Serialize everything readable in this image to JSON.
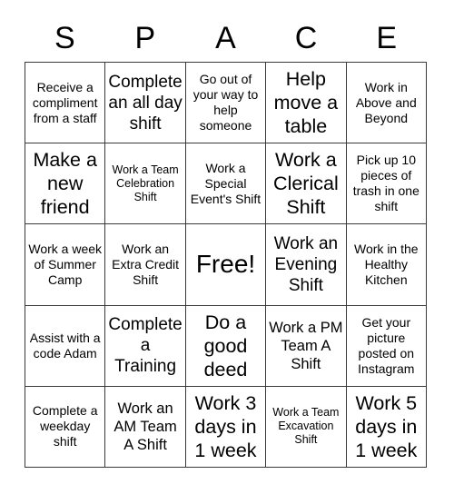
{
  "card": {
    "header_letters": [
      "S",
      "P",
      "A",
      "C",
      "E"
    ],
    "free_space_label": "Free!",
    "rows": [
      [
        {
          "text": "Receive a compliment from a staff",
          "size": "fs-sm"
        },
        {
          "text": "Complete an all day shift",
          "size": "fs-lg"
        },
        {
          "text": "Go out of your way to help someone",
          "size": "fs-sm"
        },
        {
          "text": "Help move a table",
          "size": "fs-xl"
        },
        {
          "text": "Work in Above and Beyond",
          "size": "fs-sm"
        }
      ],
      [
        {
          "text": "Make a new friend",
          "size": "fs-xl"
        },
        {
          "text": "Work a Team Celebration Shift",
          "size": "fs-xs"
        },
        {
          "text": "Work a Special Event's Shift",
          "size": "fs-sm"
        },
        {
          "text": "Work a Clerical Shift",
          "size": "fs-xl"
        },
        {
          "text": "Pick up 10 pieces of trash in one shift",
          "size": "fs-sm"
        }
      ],
      [
        {
          "text": "Work a week of Summer Camp",
          "size": "fs-sm"
        },
        {
          "text": "Work an Extra Credit Shift",
          "size": "fs-sm"
        },
        {
          "text": "Free!",
          "size": "fs-free"
        },
        {
          "text": "Work an Evening Shift",
          "size": "fs-lg"
        },
        {
          "text": "Work in the Healthy Kitchen",
          "size": "fs-sm"
        }
      ],
      [
        {
          "text": "Assist with a code Adam",
          "size": "fs-sm"
        },
        {
          "text": "Complete a Training",
          "size": "fs-lg"
        },
        {
          "text": "Do a good deed",
          "size": "fs-xl"
        },
        {
          "text": "Work a PM Team A Shift",
          "size": "fs-md"
        },
        {
          "text": "Get your picture posted on Instagram",
          "size": "fs-sm"
        }
      ],
      [
        {
          "text": "Complete a weekday shift",
          "size": "fs-sm"
        },
        {
          "text": "Work an AM Team A Shift",
          "size": "fs-md"
        },
        {
          "text": "Work 3 days in 1 week",
          "size": "fs-xl"
        },
        {
          "text": "Work a Team Excavation Shift",
          "size": "fs-xs"
        },
        {
          "text": "Work 5 days in 1 week",
          "size": "fs-xl"
        }
      ]
    ]
  }
}
